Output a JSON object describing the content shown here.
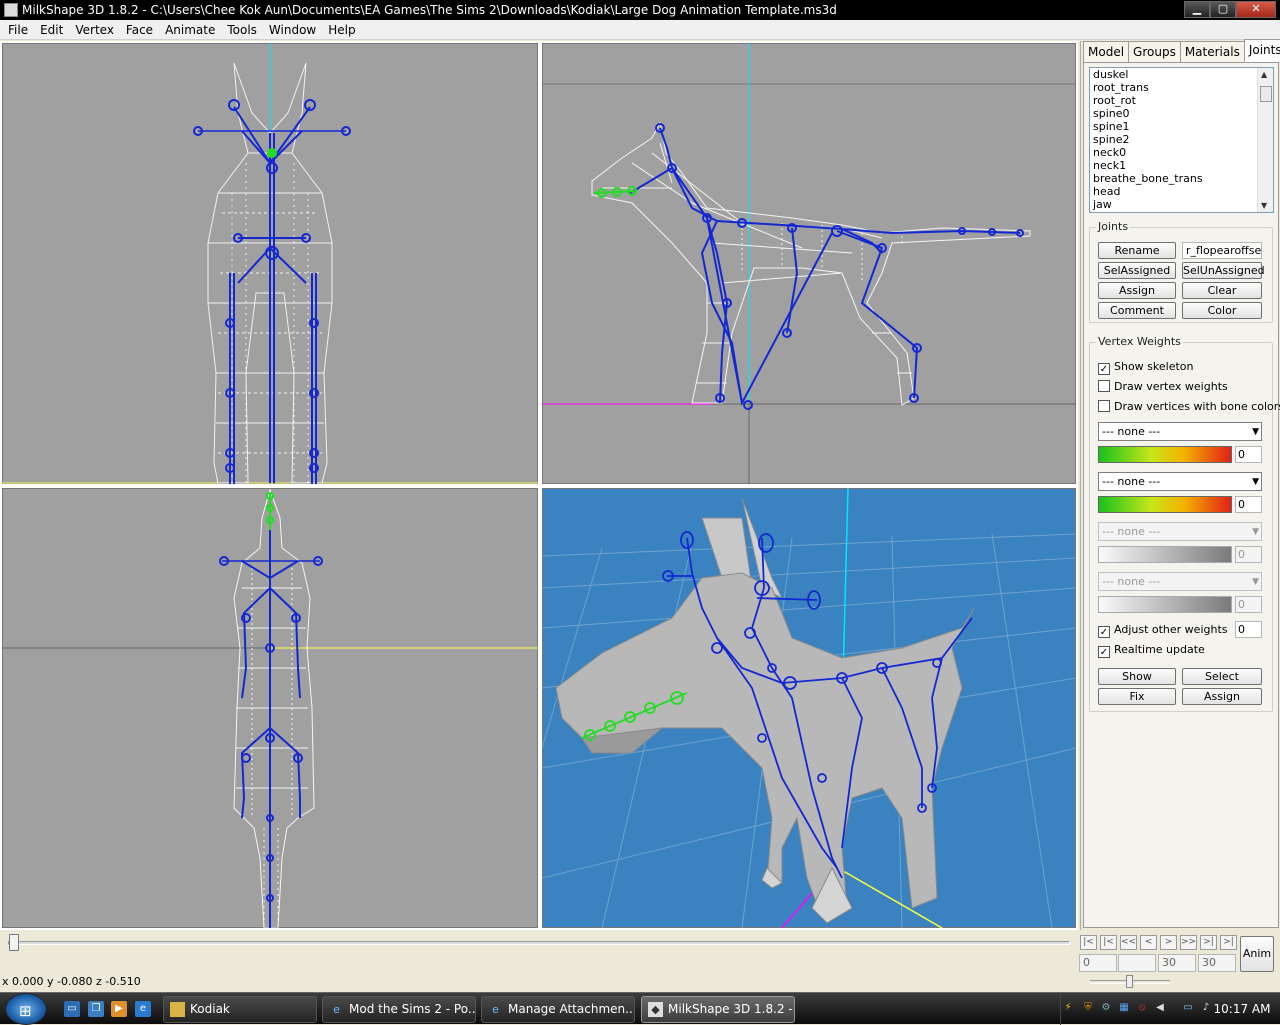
{
  "window": {
    "title": "MilkShape 3D 1.8.2 - C:\\Users\\Chee Kok Aun\\Documents\\EA Games\\The Sims 2\\Downloads\\Kodiak\\Large Dog Animation Template.ms3d",
    "minimize": "▁",
    "maximize": "▢",
    "close": "✕"
  },
  "menu": [
    "File",
    "Edit",
    "Vertex",
    "Face",
    "Animate",
    "Tools",
    "Window",
    "Help"
  ],
  "tabs": [
    "Model",
    "Groups",
    "Materials",
    "Joints"
  ],
  "active_tab": "Joints",
  "joints": {
    "list": [
      "duskel",
      "root_trans",
      "root_rot",
      "spine0",
      "spine1",
      "spine2",
      "neck0",
      "neck1",
      "breathe_bone_trans",
      "head",
      "jaw"
    ],
    "section_label": "Joints",
    "rename_label": "Rename",
    "selected_name": "r_flopearoffset",
    "sel_assigned_label": "SelAssigned",
    "sel_unassigned_label": "SelUnAssigned",
    "assign_label": "Assign",
    "clear_label": "Clear",
    "comment_label": "Comment",
    "color_label": "Color"
  },
  "vertex_weights": {
    "section_label": "Vertex Weights",
    "show_skeleton": {
      "label": "Show skeleton",
      "checked": true
    },
    "draw_vertex_weights": {
      "label": "Draw vertex weights",
      "checked": false
    },
    "draw_vertices_bone_colors": {
      "label": "Draw vertices with bone colors",
      "checked": false
    },
    "slots": [
      {
        "bone": "--- none ---",
        "weight": "0",
        "enabled": true
      },
      {
        "bone": "--- none ---",
        "weight": "0",
        "enabled": true
      },
      {
        "bone": "--- none ---",
        "weight": "0",
        "enabled": false
      },
      {
        "bone": "--- none ---",
        "weight": "0",
        "enabled": false
      }
    ],
    "adjust_other_weights": {
      "label": "Adjust other weights",
      "checked": true,
      "value": "0"
    },
    "realtime_update": {
      "label": "Realtime update",
      "checked": true
    },
    "show_label": "Show",
    "select_label": "Select",
    "fix_label": "Fix",
    "assign_label": "Assign"
  },
  "timeline": {
    "buttons": [
      "|<",
      "|<",
      "<<",
      "<",
      ">",
      ">>",
      ">|",
      ">|"
    ],
    "frame": "0",
    "start": "",
    "current": "30",
    "end": "30",
    "anim_label": "Anim"
  },
  "status": {
    "coords": "x 0.000 y -0.080 z -0.510"
  },
  "taskbar": {
    "tasks": [
      {
        "label": "Kodiak",
        "icon": "folder-icon",
        "active": false
      },
      {
        "label": "Mod the Sims 2 - Po...",
        "icon": "ie-icon",
        "active": false
      },
      {
        "label": "Manage Attachmen...",
        "icon": "ie-icon",
        "active": false
      },
      {
        "label": "MilkShape 3D 1.8.2 -...",
        "icon": "milkshape-icon",
        "active": true
      }
    ],
    "clock": "10:17 AM"
  },
  "colors": {
    "viewport_bg": "#a0a0a0",
    "viewport_3d_bg": "#3a83c0",
    "bone": "#1428d2",
    "bone_selected": "#22dd22",
    "mesh": "#ffffff",
    "axis_cyan": "#00e5ff",
    "axis_magenta": "#ff00ff",
    "axis_yellow": "#ffff40"
  }
}
